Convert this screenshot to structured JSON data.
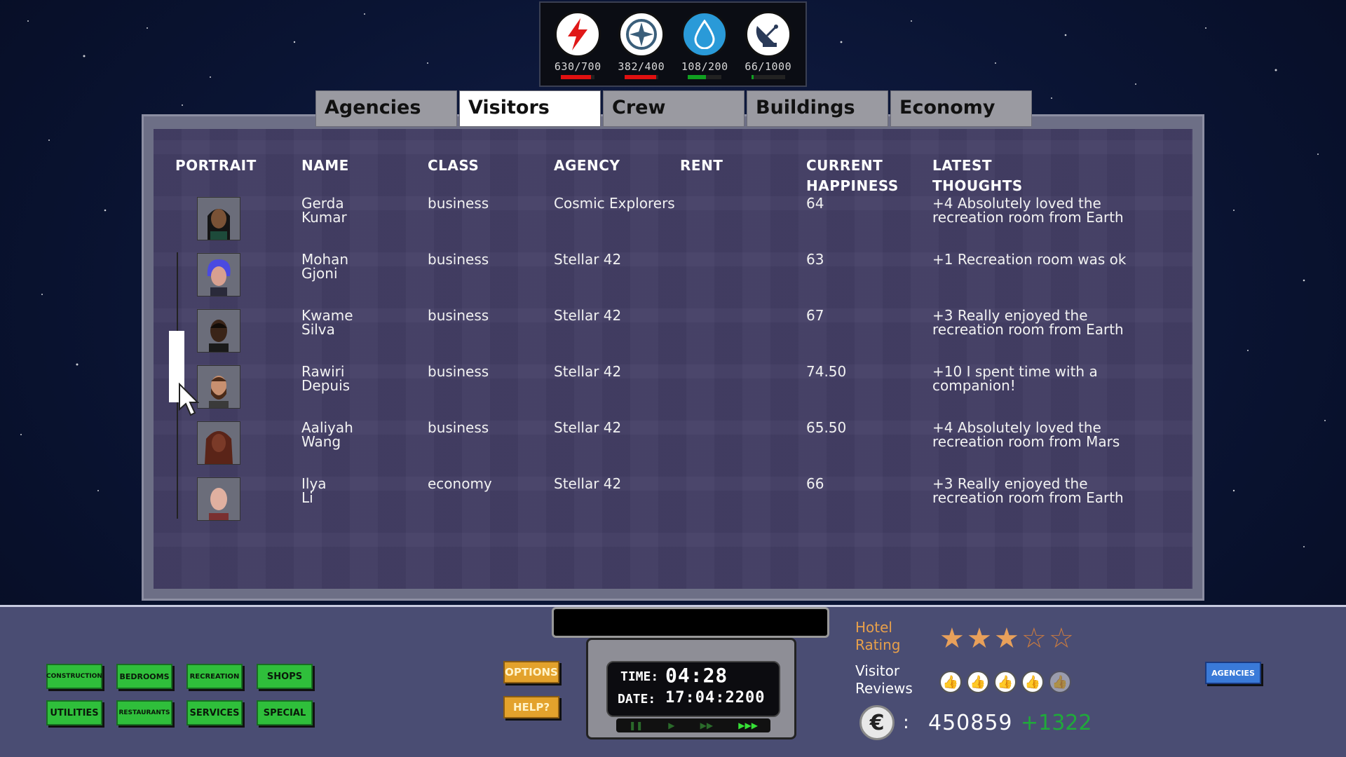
{
  "resources": {
    "power": {
      "value": "630/700",
      "bar_color": "#e01010",
      "fill": 0.9
    },
    "air": {
      "value": "382/400",
      "bar_color": "#e01010",
      "fill": 0.95
    },
    "water": {
      "value": "108/200",
      "bar_color": "#10a020",
      "fill": 0.54
    },
    "comms": {
      "value": "66/1000",
      "bar_color": "#10a020",
      "fill": 0.066
    }
  },
  "tabs": [
    "Agencies",
    "Visitors",
    "Crew",
    "Buildings",
    "Economy"
  ],
  "active_tab": "Visitors",
  "table": {
    "headers": {
      "portrait": "PORTRAIT",
      "name": "NAME",
      "class": "CLASS",
      "agency": "AGENCY",
      "rent": "RENT",
      "happiness_1": "CURRENT",
      "happiness_2": "HAPPINESS",
      "thoughts_1": "LATEST",
      "thoughts_2": "THOUGHTS"
    },
    "rows": [
      {
        "first": "Gerda",
        "last": "Kumar",
        "class": "business",
        "agency": "Cosmic Explorers",
        "happiness": "64",
        "thought_1": "+4 Absolutely loved the",
        "thought_2": "recreation room from Earth"
      },
      {
        "first": "Mohan",
        "last": "Gjoni",
        "class": "business",
        "agency": "Stellar 42",
        "happiness": "63",
        "thought_1": "+1 Recreation room was ok",
        "thought_2": ""
      },
      {
        "first": "Kwame",
        "last": "Silva",
        "class": "business",
        "agency": "Stellar 42",
        "happiness": "67",
        "thought_1": "+3 Really enjoyed the",
        "thought_2": "recreation room from Earth"
      },
      {
        "first": "Rawiri",
        "last": "Depuis",
        "class": "business",
        "agency": "Stellar 42",
        "happiness": "74.50",
        "thought_1": "+10 I spent time with a",
        "thought_2": "companion!"
      },
      {
        "first": "Aaliyah",
        "last": "Wang",
        "class": "business",
        "agency": "Stellar 42",
        "happiness": "65.50",
        "thought_1": "+4 Absolutely loved the",
        "thought_2": "recreation room from Mars"
      },
      {
        "first": "Ilya",
        "last": "Li",
        "class": "economy",
        "agency": "Stellar 42",
        "happiness": "66",
        "thought_1": "+3 Really enjoyed the",
        "thought_2": "recreation room from Earth"
      }
    ]
  },
  "build_menu": {
    "construction": "CONSTRUCTION",
    "bedrooms": "BEDROOMS",
    "recreation": "RECREATION",
    "shops": "SHOPS",
    "utilities": "UTILITIES",
    "restaurants": "RESTAURANTS",
    "services": "SERVICES",
    "special": "SPECIAL"
  },
  "options_label": "OPTIONS",
  "help_label": "HELP?",
  "clock": {
    "time_label": "TIME:",
    "time": "04:28",
    "date_label": "DATE:",
    "date": "17:04:2200"
  },
  "hotel_rating": {
    "label_1": "Hotel",
    "label_2": "Rating",
    "stars": 3,
    "max": 5
  },
  "visitor_reviews": {
    "label_1": "Visitor",
    "label_2": "Reviews",
    "thumbs_up": 4,
    "max": 5
  },
  "credits": {
    "separator": ":",
    "amount": "450859",
    "delta": "+1322"
  },
  "agencies_button": "AGENCIES"
}
